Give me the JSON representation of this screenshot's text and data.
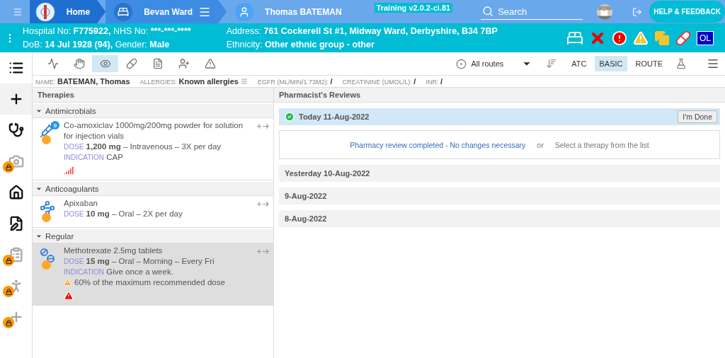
{
  "nav": {
    "crumbs": [
      {
        "kind": "home",
        "label": "Home"
      },
      {
        "kind": "ward",
        "label": "Bevan Ward"
      },
      {
        "kind": "patient",
        "label": "Thomas BATEMAN"
      }
    ],
    "build": "Training v2.0.2-ci.81",
    "search": {
      "placeholder": "Search"
    },
    "help": "HELP & FEEDBACK"
  },
  "patient": {
    "lines": [
      [
        {
          "label": "Hospital No:",
          "value": "F775922,"
        },
        {
          "label": "NHS No:",
          "value": "***-***-****"
        }
      ],
      [
        {
          "label": "DoB:",
          "value": "14 Jul 1928 (94),"
        },
        {
          "label": "Gender:",
          "value": "Male"
        }
      ]
    ],
    "address": [
      [
        {
          "label": "Address:",
          "value": "761 Cockerell St #1, Midway Ward, Derbyshire, B34 7BP"
        }
      ],
      [
        {
          "label": "Ethnicity:",
          "value": "Other ethnic group - other"
        }
      ]
    ],
    "alerts": [
      {
        "kind": "bed"
      },
      {
        "kind": "cross"
      },
      {
        "kind": "error"
      },
      {
        "kind": "warning"
      },
      {
        "kind": "copies"
      },
      {
        "kind": "pill"
      },
      {
        "kind": "badge",
        "label": "OL"
      }
    ]
  },
  "sidebar": [
    {
      "kind": "list",
      "selected": false,
      "locked": false
    },
    {
      "kind": "add",
      "selected": true,
      "locked": false
    },
    {
      "kind": "stethoscope",
      "selected": false,
      "locked": false
    },
    {
      "kind": "camera",
      "selected": false,
      "locked": true
    },
    {
      "kind": "home",
      "selected": false,
      "locked": false
    },
    {
      "kind": "edit",
      "selected": false,
      "locked": false
    },
    {
      "kind": "clipboard",
      "selected": false,
      "locked": true
    },
    {
      "kind": "walk",
      "selected": false,
      "locked": true
    },
    {
      "kind": "plus",
      "selected": false,
      "locked": true
    }
  ],
  "toolbar": {
    "tools": [
      {
        "kind": "chart",
        "selected": false
      },
      {
        "kind": "hand",
        "selected": false
      },
      {
        "kind": "eye",
        "selected": true
      },
      {
        "kind": "pill",
        "selected": false
      },
      {
        "kind": "doc",
        "selected": false
      },
      {
        "kind": "ref",
        "selected": false
      },
      {
        "kind": "warning",
        "selected": false
      }
    ],
    "route_filter": "All routes",
    "views": [
      {
        "label": "ATC",
        "selected": false
      },
      {
        "label": "BASIC",
        "selected": true
      },
      {
        "label": "ROUTE",
        "selected": false
      }
    ]
  },
  "info": [
    {
      "label": "NAME:",
      "value": "BATEMAN, Thomas"
    },
    {
      "label": "ALLERGIES:",
      "value": "Known allergies",
      "menu": true
    },
    {
      "label": "EGFR (ML/MIN/1.73M2):",
      "value": "/"
    },
    {
      "label": "CREATININE (UMOL/L):",
      "value": "/"
    },
    {
      "label": "INR:",
      "value": "/"
    }
  ],
  "therapies": {
    "title": "Therapies",
    "groups": [
      {
        "name": "Antimicrobials",
        "expanded": true,
        "items": [
          {
            "kind": "syringe",
            "count": "0",
            "name": "Co-amoxiclav 1000mg/200mg powder for solution for injection vials",
            "dose_label": "DOSE",
            "dose": "1,200 mg",
            "route": "– Intravenous – 3X per day",
            "indication_label": "INDICATION",
            "indication": "CAP",
            "selected": false,
            "marks": [
              {
                "kind": "signal"
              }
            ]
          }
        ]
      },
      {
        "name": "Anticoagulants",
        "expanded": true,
        "items": [
          {
            "kind": "snake",
            "name": "Apixaban",
            "dose_label": "DOSE",
            "dose": "10 mg",
            "route": "– Oral – 2X per day",
            "selected": false
          }
        ]
      },
      {
        "name": "Regular",
        "expanded": true,
        "items": [
          {
            "kind": "tablet",
            "name": "Methotrexate 2.5mg tablets",
            "dose_label": "DOSE",
            "dose": "15 mg",
            "route": "– Oral – Morning – Every Fri",
            "indication_label": "INDICATION",
            "indication": "Give once a week.",
            "warning": "60% of the maximum recommended dose",
            "selected": true,
            "marks": [
              {
                "kind": "alert"
              }
            ]
          }
        ]
      }
    ]
  },
  "reviews": {
    "title": "Pharmacist's Reviews",
    "days": [
      {
        "label": "Today 11-Aug-2022",
        "expanded": true,
        "done": true,
        "button": "I'm Done",
        "link": "Pharmacy review completed - No changes necessary",
        "or": "or",
        "hint": "Select a therapy from the list"
      },
      {
        "label": "Yesterday 10-Aug-2022",
        "expanded": false
      },
      {
        "label": "9-Aug-2022",
        "expanded": false
      },
      {
        "label": "8-Aug-2022",
        "expanded": false
      }
    ]
  }
}
